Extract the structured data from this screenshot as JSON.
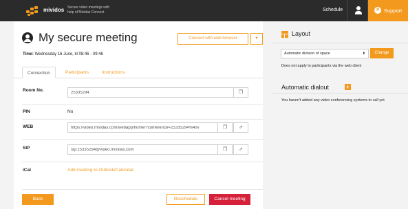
{
  "topbar": {
    "brand": "mividos",
    "tagline": "Secure video meetings with help of Mividas Connect",
    "schedule_label": "Schedule",
    "user_icon": "user-icon",
    "support_label": "Support",
    "support_icon": "support-lifering-icon",
    "accent": "#f39a1e"
  },
  "meeting": {
    "title": "My secure meeting",
    "title_icon": "user-circle-icon",
    "connect_label": "Connect with web browser",
    "connect_dropdown_glyph": "▼",
    "time_label": "Time:",
    "time_value": "Wednesday 16 June, kl 08:46 - 09:46"
  },
  "tabs": [
    {
      "label": "Connection",
      "active": true
    },
    {
      "label": "Participants",
      "active": false
    },
    {
      "label": "Instructions",
      "active": false
    }
  ],
  "rows": {
    "room_label": "Room No.",
    "room_value": "25335294",
    "pin_label": "PIN",
    "pin_value": "No",
    "web_label": "WEB",
    "web_value": "https://video.mividas.com/webapp/home/?conference=25335294%40v",
    "sip_label": "SIP",
    "sip_value": "sip:25335294@video.mividas.com",
    "ical_label": "iCal",
    "ical_link": "Add meeting to Outlook/Calendar",
    "copy_glyph": "❐",
    "open_glyph": "⇗"
  },
  "actions": {
    "back_label": "Back",
    "reschedule_label": "Reschedule",
    "cancel_label": "Cancel meeting",
    "cancel_color": "#d6213b"
  },
  "sidebar": {
    "layout_title": "Layout",
    "layout_icon": "layout-grid-icon",
    "layout_selected": "Automatic division of space",
    "change_label": "Change",
    "layout_note": "Does not apply to participants via the web client",
    "dialout_title": "Automatic dialout",
    "dialout_add_glyph": "+",
    "dialout_note": "You haven't added any video conferencing systems to call yet"
  }
}
